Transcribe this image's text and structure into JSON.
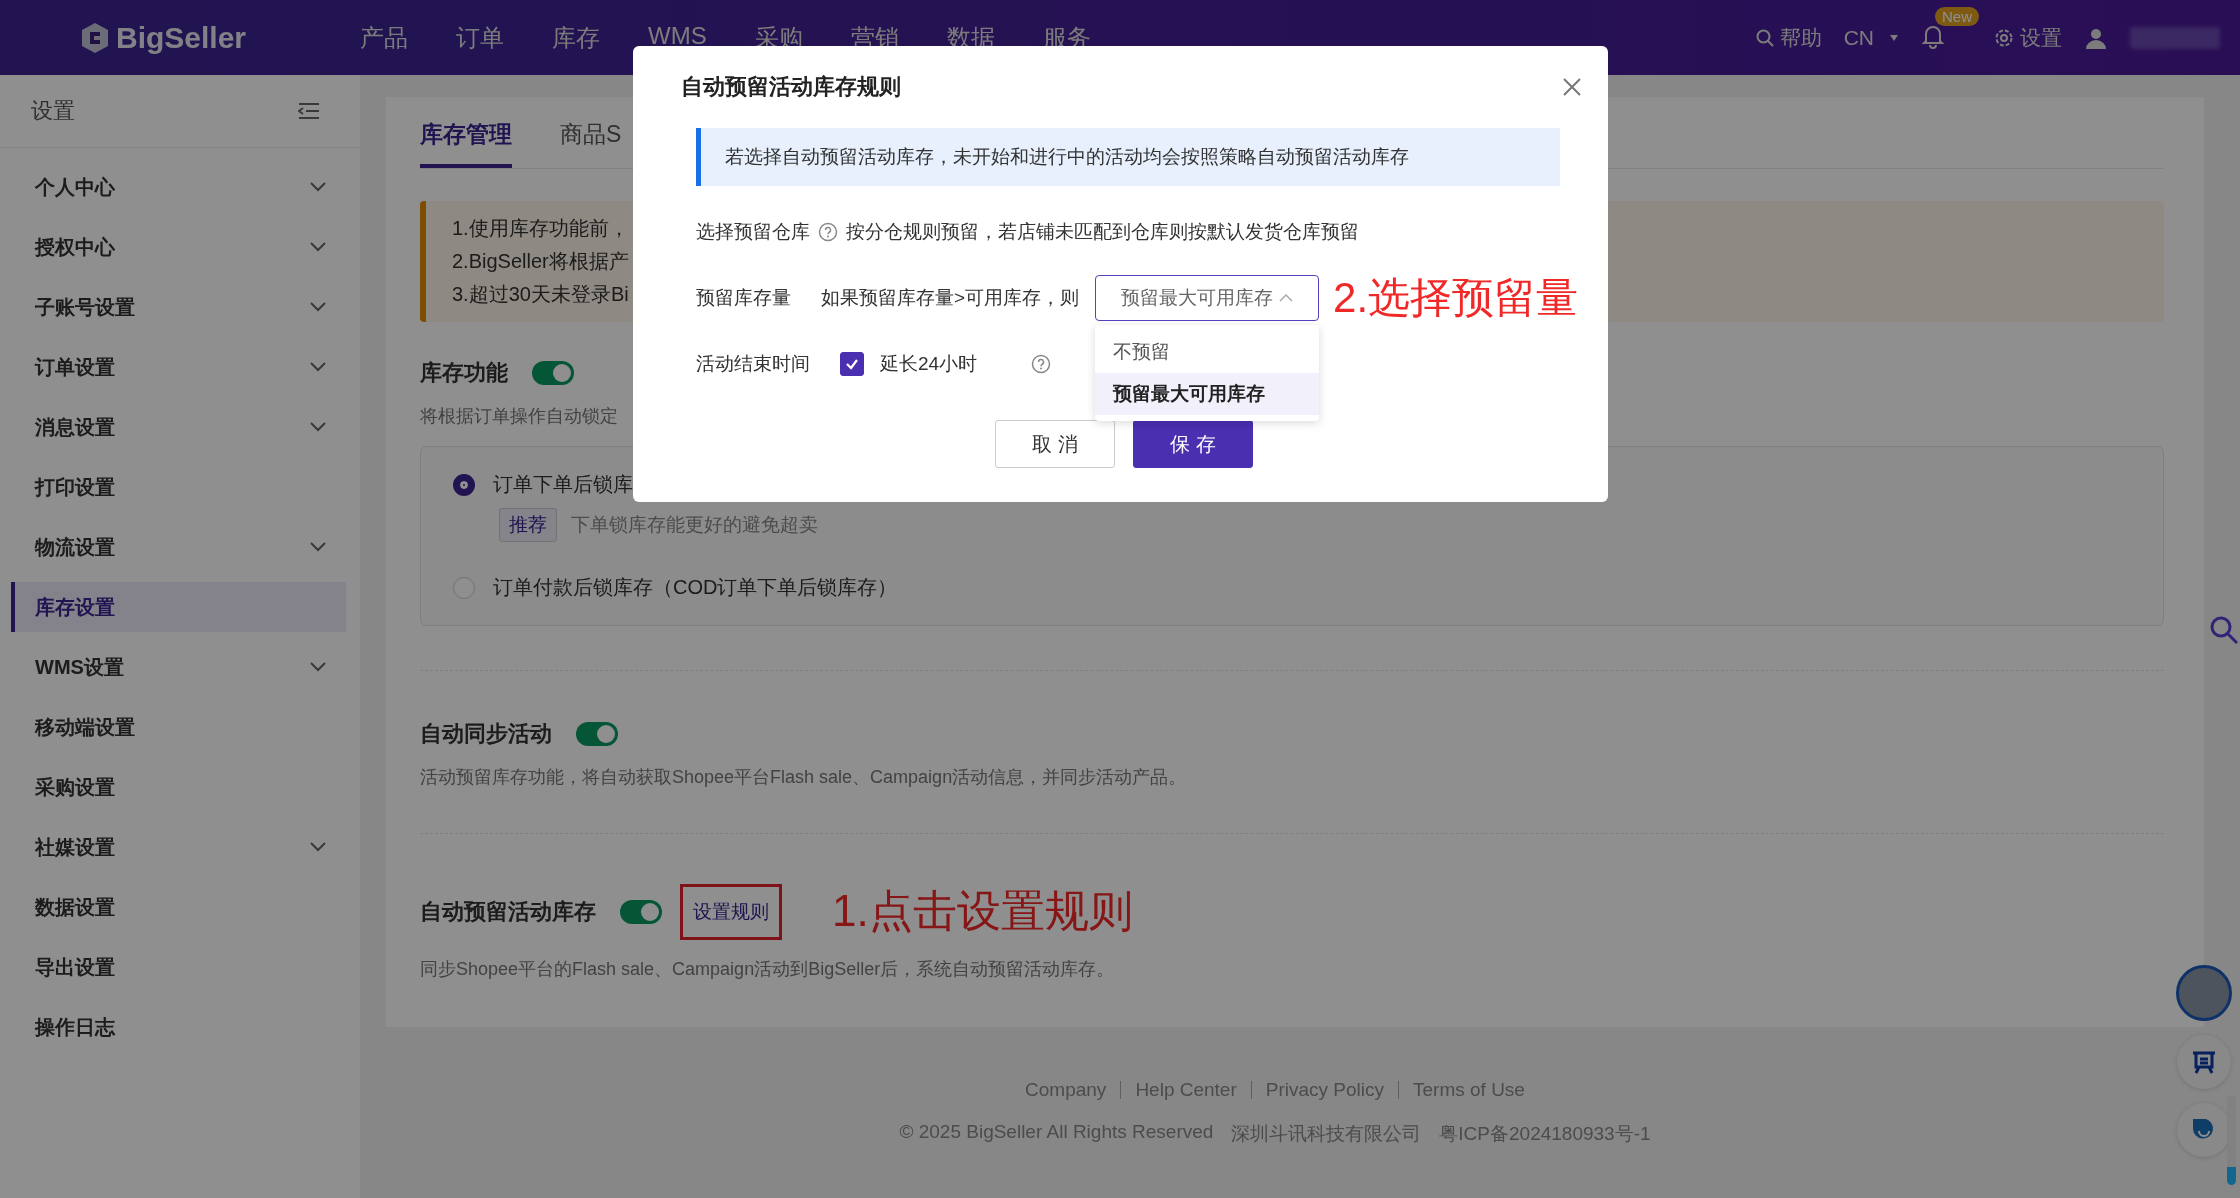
{
  "top_nav": {
    "logo": "BigSeller",
    "menu": [
      {
        "label": "产品"
      },
      {
        "label": "订单"
      },
      {
        "label": "库存"
      },
      {
        "label": "WMS"
      },
      {
        "label": "采购"
      },
      {
        "label": "营销"
      },
      {
        "label": "数据"
      },
      {
        "label": "服务"
      }
    ],
    "help": "帮助",
    "language": "CN",
    "notification_badge": "New",
    "settings": "设置"
  },
  "sidebar": {
    "title": "设置",
    "items": [
      {
        "label": "个人中心",
        "expandable": true,
        "selected": false
      },
      {
        "label": "授权中心",
        "expandable": true,
        "selected": false
      },
      {
        "label": "子账号设置",
        "expandable": true,
        "selected": false
      },
      {
        "label": "订单设置",
        "expandable": true,
        "selected": false
      },
      {
        "label": "消息设置",
        "expandable": true,
        "selected": false
      },
      {
        "label": "打印设置",
        "expandable": false,
        "selected": false
      },
      {
        "label": "物流设置",
        "expandable": true,
        "selected": false
      },
      {
        "label": "库存设置",
        "expandable": false,
        "selected": true
      },
      {
        "label": "WMS设置",
        "expandable": true,
        "selected": false
      },
      {
        "label": "移动端设置",
        "expandable": false,
        "selected": false
      },
      {
        "label": "采购设置",
        "expandable": false,
        "selected": false
      },
      {
        "label": "社媒设置",
        "expandable": true,
        "selected": false
      },
      {
        "label": "数据设置",
        "expandable": false,
        "selected": false
      },
      {
        "label": "导出设置",
        "expandable": false,
        "selected": false
      },
      {
        "label": "操作日志",
        "expandable": false,
        "selected": false
      }
    ]
  },
  "tabs": [
    {
      "label": "库存管理",
      "selected": true
    },
    {
      "label": "商品S",
      "selected": false
    }
  ],
  "notice_lines": [
    "1.使用库存功能前，",
    "2.BigSeller将根据产",
    "3.超过30天未登录Bi"
  ],
  "inventory_feature": {
    "title": "库存功能",
    "on": true,
    "description": "将根据订单操作自动锁定",
    "options": [
      {
        "label": "订单下单后锁库",
        "selected": true,
        "tag": "推荐",
        "hint": "下单锁库存能更好的避免超卖"
      },
      {
        "label": "订单付款后锁库存（COD订单下单后锁库存）",
        "selected": false
      }
    ]
  },
  "sections": [
    {
      "title": "自动同步活动",
      "on": true,
      "description": "活动预留库存功能，将自动获取Shopee平台Flash sale、Campaign活动信息，并同步活动产品。"
    },
    {
      "title": "自动预留活动库存",
      "on": true,
      "link": "设置规则",
      "annotation": "1.点击设置规则",
      "description": "同步Shopee平台的Flash sale、Campaign活动到BigSeller后，系统自动预留活动库存。"
    }
  ],
  "footer": {
    "links": [
      "Company",
      "Help Center",
      "Privacy Policy",
      "Terms of Use"
    ],
    "copyright": "© 2025 BigSeller All Rights Reserved",
    "company": "深圳斗讯科技有限公司",
    "icp": "粤ICP备2024180933号-1"
  },
  "modal": {
    "title": "自动预留活动库存规则",
    "info": "若选择自动预留活动库存，未开始和进行中的活动均会按照策略自动预留活动库存",
    "warehouse": {
      "label": "选择预留仓库",
      "text": "按分仓规则预留，若店铺未匹配到仓库则按默认发货仓库预留"
    },
    "reserve_qty": {
      "label": "预留库存量",
      "condition": "如果预留库存量>可用库存，则",
      "value": "预留最大可用库存",
      "expanded": true,
      "annotation": "2.选择预留量",
      "options": [
        {
          "label": "不预留",
          "selected": false
        },
        {
          "label": "预留最大可用库存",
          "selected": true
        }
      ]
    },
    "end_time": {
      "label": "活动结束时间",
      "checked": true,
      "option": "延长24小时"
    },
    "buttons": [
      {
        "label": "取 消",
        "kind": "secondary"
      },
      {
        "label": "保 存",
        "kind": "primary"
      }
    ]
  }
}
